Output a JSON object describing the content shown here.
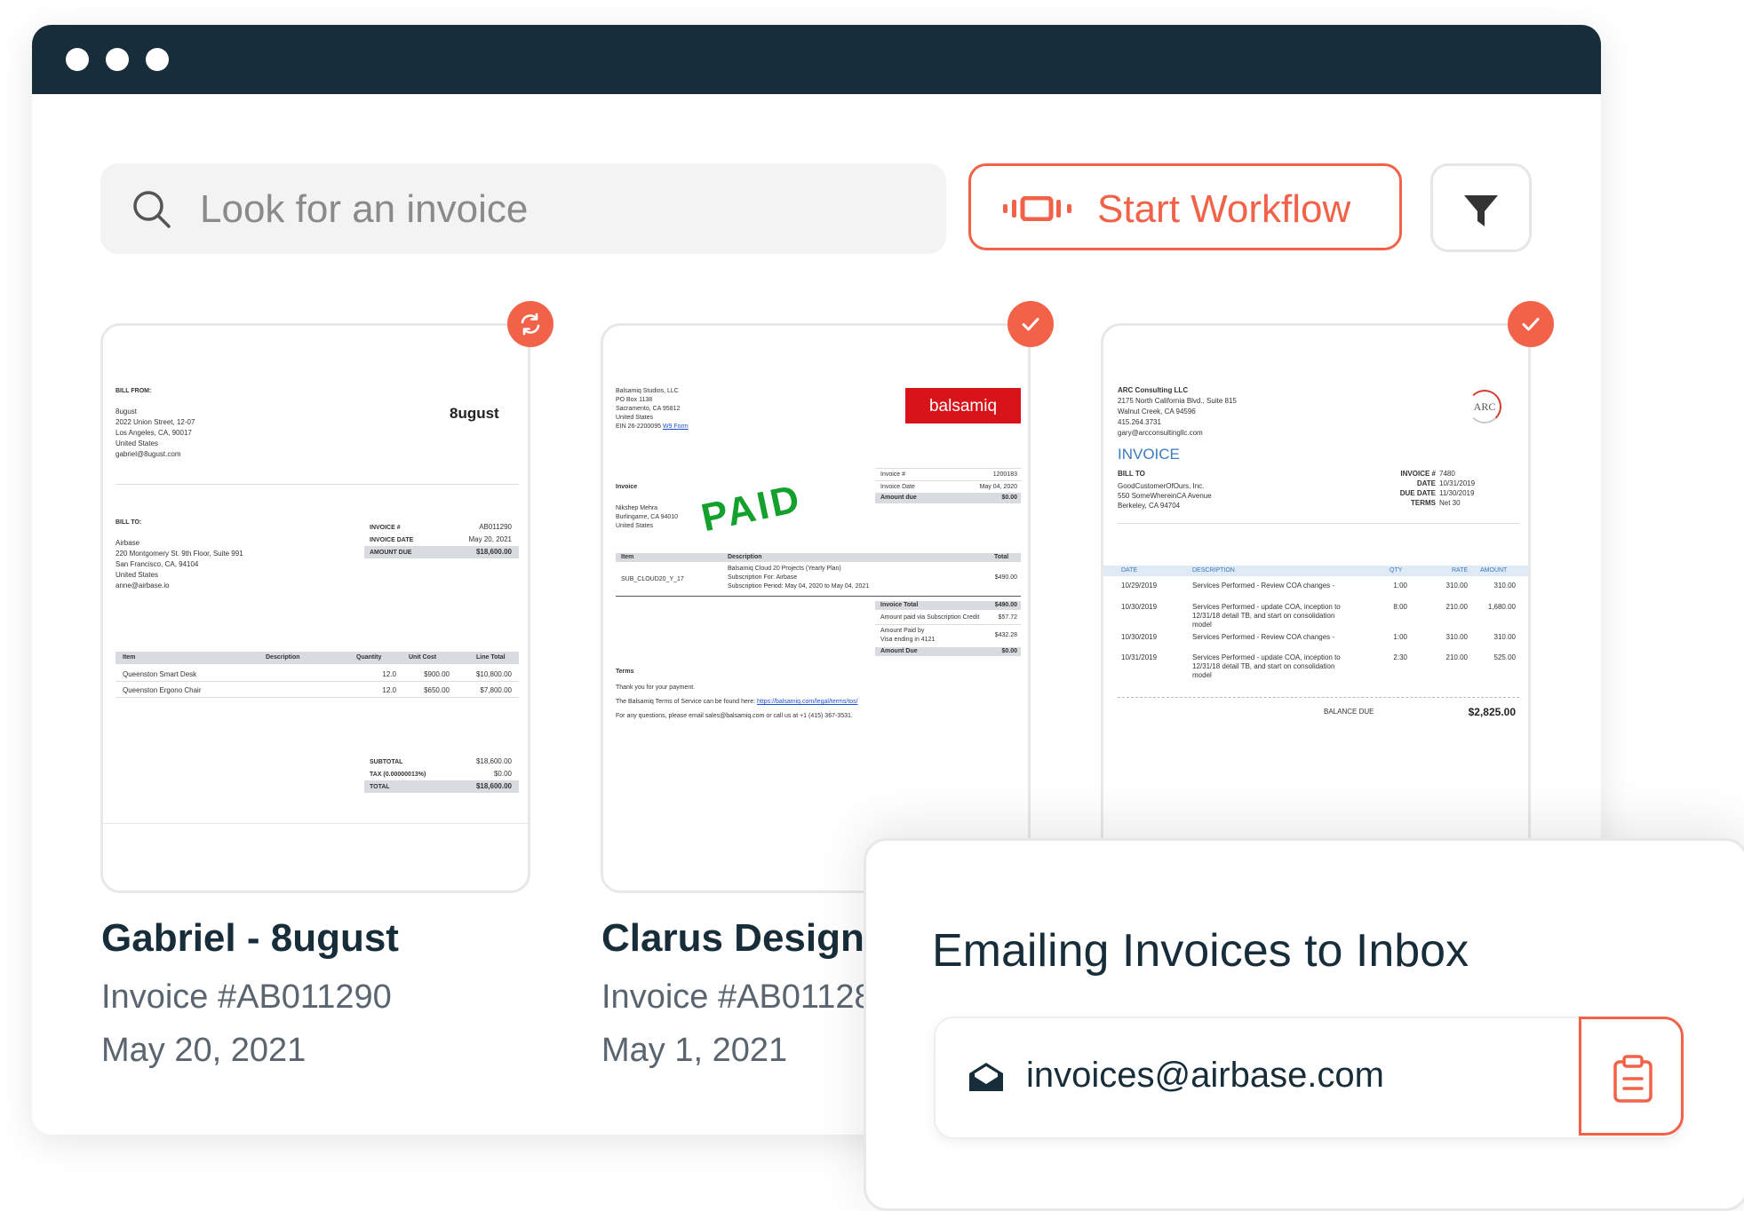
{
  "search": {
    "placeholder": "Look for an invoice",
    "icon": "search-icon"
  },
  "toolbar": {
    "workflow_label": "Start Workflow",
    "workflow_icon": "workflow-icon",
    "filter_icon": "filter-icon"
  },
  "colors": {
    "accent": "#f26248",
    "titlebar": "#172d3a",
    "text_dark": "#172d3a",
    "text_muted": "#5a6570"
  },
  "cards": [
    {
      "title": "Gabriel - 8ugust",
      "invoice_no": "Invoice #AB011290",
      "date": "May 20, 2021",
      "status_icon": "sync-icon",
      "preview": {
        "bill_from_label": "BILL FROM:",
        "from_lines": [
          "8ugust",
          "2022 Union Street, 12-07",
          "Los Angeles, CA, 90017",
          "United States",
          "gabriel@8ugust.com"
        ],
        "logo": "8ugust",
        "bill_to_label": "BILL TO:",
        "to_lines": [
          "Airbase",
          "220 Montgomery St. 9th Floor, Suite 991",
          "San Francisco, CA, 94104",
          "United States",
          "anne@airbase.io"
        ],
        "meta": [
          {
            "label": "INVOICE #",
            "value": "AB011290"
          },
          {
            "label": "INVOICE DATE",
            "value": "May 20, 2021"
          },
          {
            "label": "AMOUNT DUE",
            "value": "$18,600.00"
          }
        ],
        "table_headers": [
          "Item",
          "Description",
          "Quantity",
          "Unit Cost",
          "Line Total"
        ],
        "rows": [
          {
            "item": "Queenston Smart Desk",
            "qty": "12.0",
            "unit": "$900.00",
            "total": "$10,800.00"
          },
          {
            "item": "Queenston Ergono Chair",
            "qty": "12.0",
            "unit": "$650.00",
            "total": "$7,800.00"
          }
        ],
        "totals": [
          {
            "label": "SUBTOTAL",
            "value": "$18,600.00"
          },
          {
            "label": "TAX (0.00000013%)",
            "value": "$0.00"
          },
          {
            "label": "TOTAL",
            "value": "$18,600.00"
          }
        ]
      }
    },
    {
      "title": "Clarus Design",
      "invoice_no": "Invoice #AB01128",
      "date": "May 1, 2021",
      "status_icon": "check-icon",
      "preview": {
        "from_lines": [
          "Balsamiq Studios, LLC",
          "PO Box 1138",
          "Sacramento, CA 95812",
          "United States"
        ],
        "ein": "EIN 26-2200095",
        "w9": "W9 Form",
        "logo": "balsamiq",
        "invoice_label": "Invoice",
        "to_lines": [
          "Nikshep Mehra",
          "Burlingame, CA 94010",
          "United States"
        ],
        "stamp": "PAID",
        "meta": [
          {
            "label": "Invoice #",
            "value": "1200183"
          },
          {
            "label": "Invoice Date",
            "value": "May 04, 2020"
          },
          {
            "label": "Amount due",
            "value": "$0.00"
          }
        ],
        "table_headers": [
          "Item",
          "Description",
          "Total"
        ],
        "row": {
          "item": "SUB_CLOUD20_Y_17",
          "desc": [
            "Balsamiq Cloud 20 Projects (Yearly Plan)",
            "Subscription For: Airbase",
            "Subscription Period: May 04, 2020 to May 04, 2021"
          ],
          "total": "$490.00"
        },
        "totals": [
          {
            "label": "Invoice Total",
            "value": "$490.00"
          },
          {
            "label": "Amount paid via Subscription Credit",
            "value": "$57.72"
          },
          {
            "label": "Amount Paid by",
            "label2": "Visa ending in 4121",
            "value": "$432.28"
          },
          {
            "label": "Amount Due",
            "value": "$0.00"
          }
        ],
        "terms_label": "Terms",
        "terms_lines": [
          "Thank you for your payment.",
          "The Balsamiq Terms of Service can be found here:",
          "For any questions, please email sales@balsamiq.com or call us at +1 (415) 367-3531."
        ],
        "terms_link": "https://balsamiq.com/legal/terms/tos/"
      }
    },
    {
      "status_icon": "check-icon",
      "preview": {
        "from_lines": [
          "ARC Consulting LLC",
          "2175 North California Blvd., Suite 815",
          "Walnut Creek, CA  94596",
          "415.264.3731",
          "gary@arcconsultingllc.com"
        ],
        "logo": "ARC",
        "heading": "INVOICE",
        "bill_to_label": "BILL TO",
        "to_lines": [
          "GoodCustomerOfOurs, Inc.",
          "550 SomeWhereinCA Avenue",
          "Berkeley, CA 94704"
        ],
        "meta": [
          {
            "label": "INVOICE #",
            "value": "7480"
          },
          {
            "label": "DATE",
            "value": "10/31/2019"
          },
          {
            "label": "DUE DATE",
            "value": "11/30/2019"
          },
          {
            "label": "TERMS",
            "value": "Net 30"
          }
        ],
        "table_headers": [
          "DATE",
          "DESCRIPTION",
          "QTY",
          "RATE",
          "AMOUNT"
        ],
        "rows": [
          {
            "date": "10/29/2019",
            "desc": [
              "Services Performed - Review COA changes -"
            ],
            "qty": "1:00",
            "rate": "310.00",
            "amount": "310.00"
          },
          {
            "date": "10/30/2019",
            "desc": [
              "Services Performed - update COA, inception to",
              "12/31/18 detail TB, and start on consolidation",
              "model"
            ],
            "qty": "8:00",
            "rate": "210.00",
            "amount": "1,680.00"
          },
          {
            "date": "10/30/2019",
            "desc": [
              "Services Performed - Review COA changes -"
            ],
            "qty": "1:00",
            "rate": "310.00",
            "amount": "310.00"
          },
          {
            "date": "10/31/2019",
            "desc": [
              "Services Performed - update COA, inception to",
              "12/31/18 detail TB, and start on consolidation",
              "model"
            ],
            "qty": "2:30",
            "rate": "210.00",
            "amount": "525.00"
          }
        ],
        "balance_label": "BALANCE DUE",
        "balance_value": "$2,825.00"
      }
    }
  ],
  "email_panel": {
    "title": "Emailing Invoices to Inbox",
    "address": "invoices@airbase.com",
    "mail_icon": "mail-icon",
    "copy_icon": "clipboard-icon"
  }
}
